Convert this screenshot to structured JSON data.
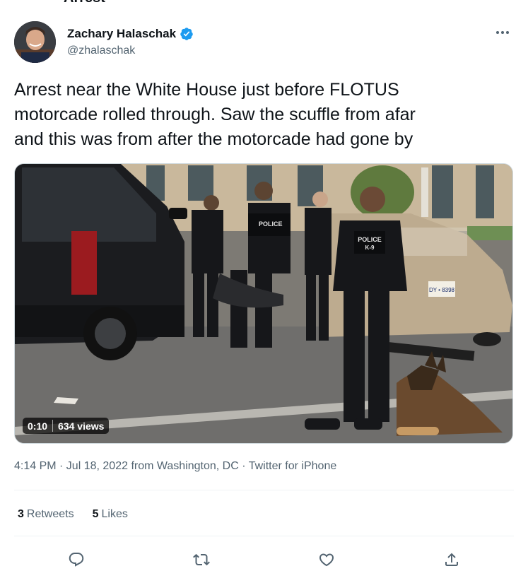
{
  "partial_title": "Arrest",
  "author": {
    "name": "Zachary Halaschak",
    "handle": "@zhalaschak",
    "verified": true
  },
  "tweet": {
    "text_lines": [
      "Arrest near the White House just before FLOTUS",
      "motorcade rolled through. Saw the scuffle from afar",
      "and this was from after the motorcade had gone by"
    ]
  },
  "media": {
    "type": "video",
    "duration": "0:10",
    "views": "634 views",
    "vest_label_1": "POLICE",
    "vest_label_2": "POLICE",
    "vest_sub_2": "K-9",
    "plate": "DY • 8398"
  },
  "meta": {
    "time_date": "4:14 PM · Jul 18, 2022",
    "from_label": "from",
    "location": "Washington, DC",
    "dot": "·",
    "source": "Twitter for iPhone"
  },
  "stats": {
    "retweets_count": "3",
    "retweets_label": "Retweets",
    "likes_count": "5",
    "likes_label": "Likes"
  },
  "colors": {
    "text": "#0f1419",
    "secondary": "#536471",
    "verified": "#1d9bf0",
    "divider": "#eff3f4"
  },
  "icons": [
    "verified-badge-icon",
    "more-icon",
    "reply-icon",
    "retweet-icon",
    "like-icon",
    "share-icon"
  ]
}
